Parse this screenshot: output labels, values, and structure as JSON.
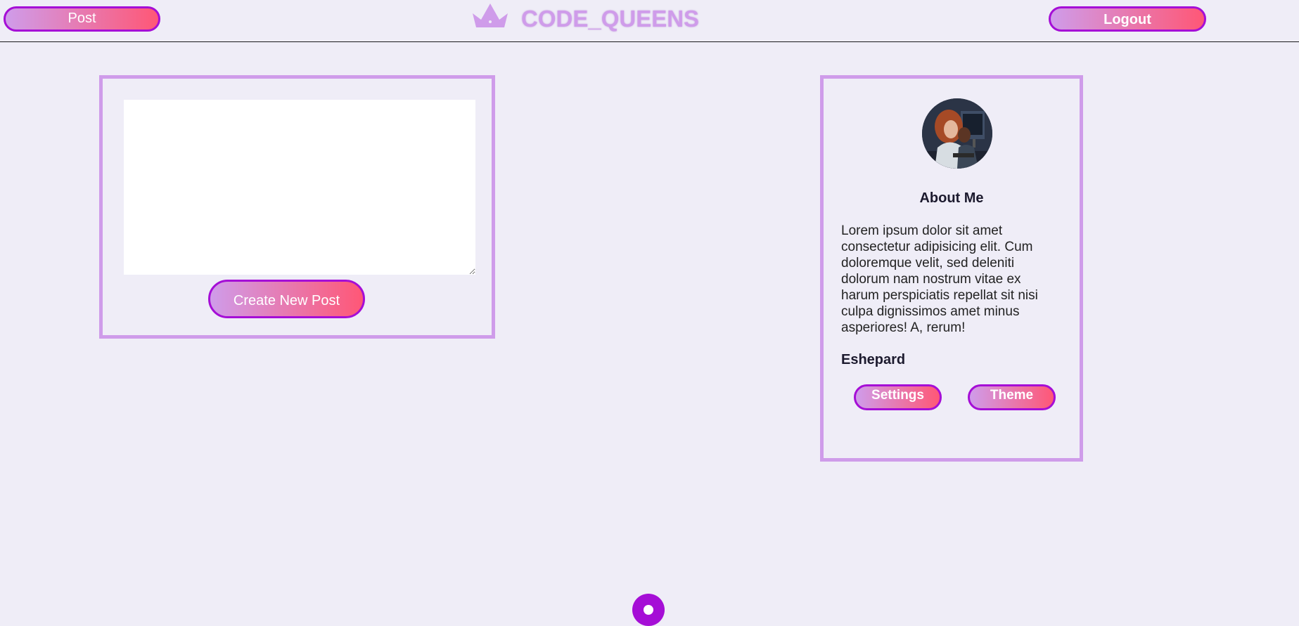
{
  "header": {
    "post_label": "Post",
    "brand_name": "CODE_QUEENS",
    "brand_icon": "crown-icon",
    "logout_label": "Logout"
  },
  "post_panel": {
    "textarea_value": "",
    "create_post_label": "Create New Post"
  },
  "profile": {
    "avatar": "avatar-photo",
    "about_title": "About Me",
    "about_text": "Lorem ipsum dolor sit amet consectetur adipisicing elit. Cum doloremque velit, sed deleniti dolorum nam nostrum vitae ex harum perspiciatis repellat sit nisi culpa dignissimos amet minus asperiores! A, rerum!",
    "username": "Eshepard",
    "settings_label": "Settings",
    "theme_label": "Theme"
  },
  "colors": {
    "background": "#efedf7",
    "accent_light": "#cf9cea",
    "accent_pink": "#ff5776",
    "accent_purple": "#a50ed6",
    "text_dark": "#1c1a2e"
  }
}
